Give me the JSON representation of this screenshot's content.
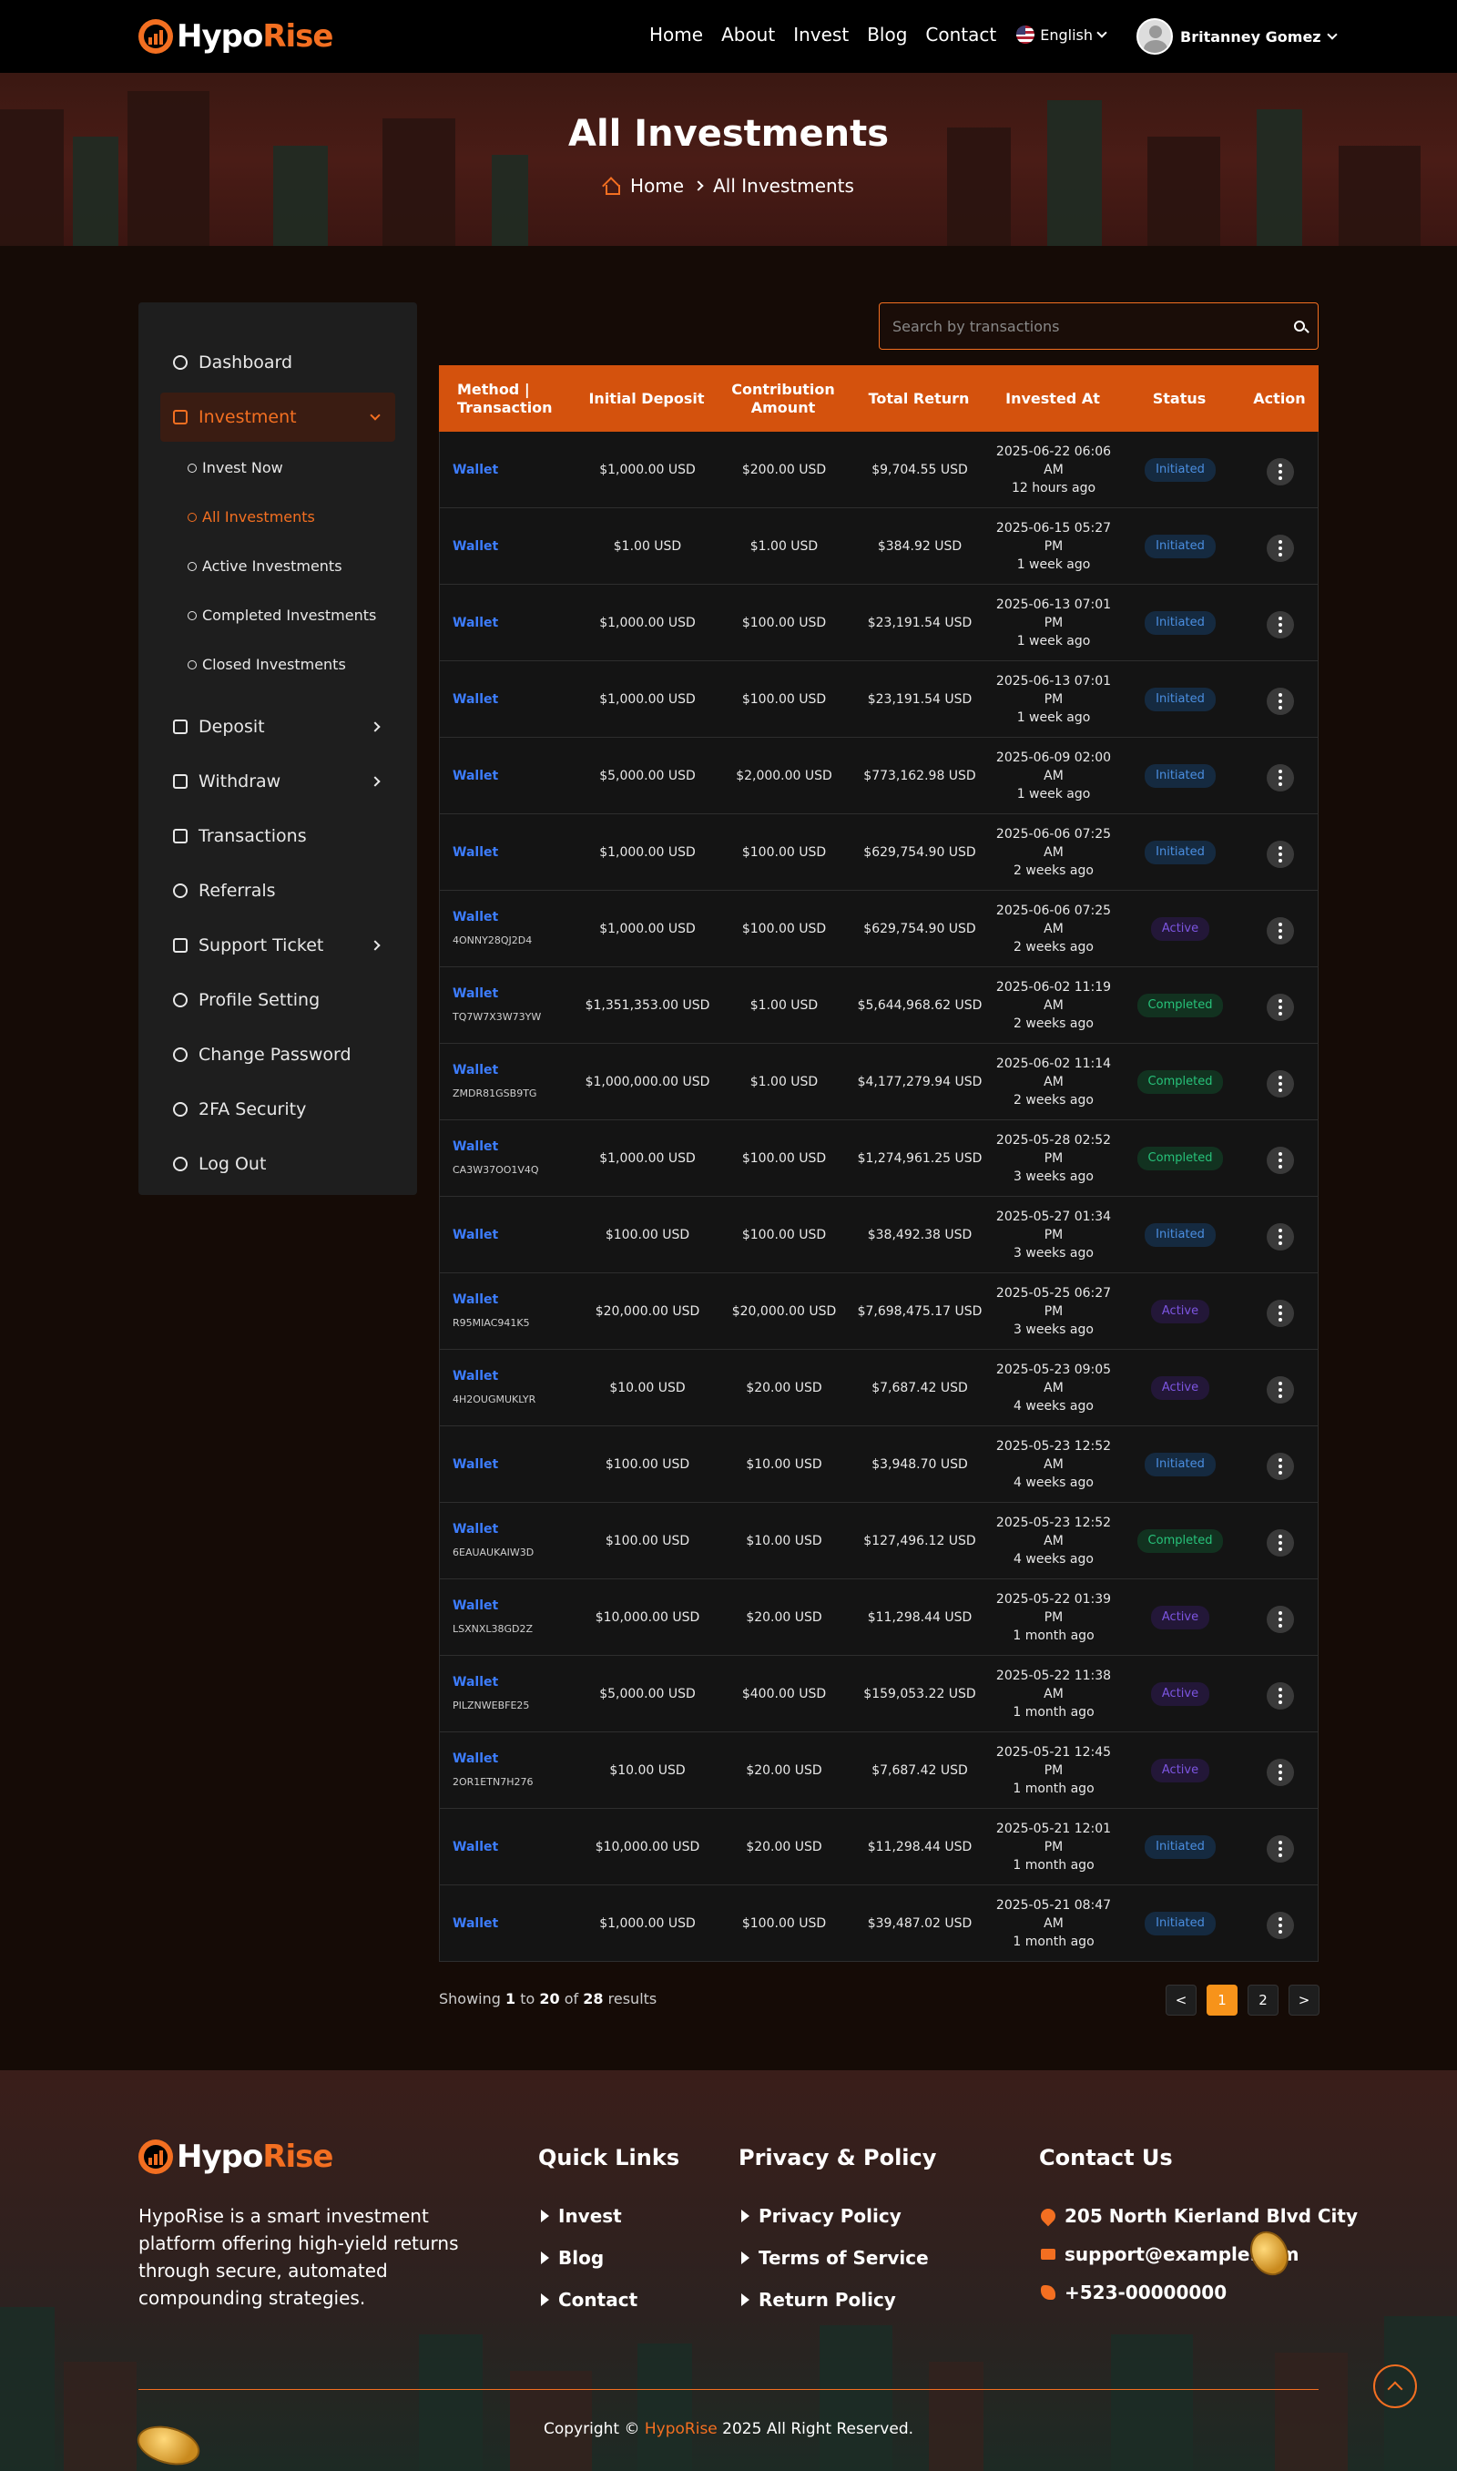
{
  "brand": {
    "name_white": "Hypo",
    "name_orange": "Rise"
  },
  "nav": {
    "items": [
      "Home",
      "About",
      "Invest",
      "Blog",
      "Contact"
    ],
    "language": "English"
  },
  "user": {
    "name": "Britanney Gomez"
  },
  "hero": {
    "title": "All Investments",
    "breadcrumb_home": "Home",
    "breadcrumb_current": "All Investments"
  },
  "sidebar": {
    "items": [
      {
        "label": "Dashboard",
        "icon": "gauge-icon"
      },
      {
        "label": "Investment",
        "icon": "chart-icon",
        "active": true
      },
      {
        "label": "Deposit",
        "icon": "wallet-icon"
      },
      {
        "label": "Withdraw",
        "icon": "withdraw-icon"
      },
      {
        "label": "Transactions",
        "icon": "swap-icon"
      },
      {
        "label": "Referrals",
        "icon": "handshake-icon"
      },
      {
        "label": "Support Ticket",
        "icon": "ticket-icon"
      },
      {
        "label": "Profile Setting",
        "icon": "user-icon"
      },
      {
        "label": "Change Password",
        "icon": "key-icon"
      },
      {
        "label": "2FA Security",
        "icon": "shield-user-icon"
      },
      {
        "label": "Log Out",
        "icon": "logout-icon"
      }
    ],
    "sub_items": [
      "Invest Now",
      "All Investments",
      "Active Investments",
      "Completed Investments",
      "Closed Investments"
    ]
  },
  "search": {
    "placeholder": "Search by transactions"
  },
  "table": {
    "headers": [
      "Method | Transaction",
      "Initial Deposit",
      "Contribution Amount",
      "Total Return",
      "Invested At",
      "Status",
      "Action"
    ],
    "rows": [
      {
        "method": "Wallet",
        "tx": "",
        "initial": "$1,000.00 USD",
        "contribution": "$200.00 USD",
        "total": "$9,704.55 USD",
        "date": "2025-06-22 06:06 AM",
        "ago": "12 hours ago",
        "status": "Initiated"
      },
      {
        "method": "Wallet",
        "tx": "",
        "initial": "$1.00 USD",
        "contribution": "$1.00 USD",
        "total": "$384.92 USD",
        "date": "2025-06-15 05:27 PM",
        "ago": "1 week ago",
        "status": "Initiated"
      },
      {
        "method": "Wallet",
        "tx": "",
        "initial": "$1,000.00 USD",
        "contribution": "$100.00 USD",
        "total": "$23,191.54 USD",
        "date": "2025-06-13 07:01 PM",
        "ago": "1 week ago",
        "status": "Initiated"
      },
      {
        "method": "Wallet",
        "tx": "",
        "initial": "$1,000.00 USD",
        "contribution": "$100.00 USD",
        "total": "$23,191.54 USD",
        "date": "2025-06-13 07:01 PM",
        "ago": "1 week ago",
        "status": "Initiated"
      },
      {
        "method": "Wallet",
        "tx": "",
        "initial": "$5,000.00 USD",
        "contribution": "$2,000.00 USD",
        "total": "$773,162.98 USD",
        "date": "2025-06-09 02:00 AM",
        "ago": "1 week ago",
        "status": "Initiated"
      },
      {
        "method": "Wallet",
        "tx": "",
        "initial": "$1,000.00 USD",
        "contribution": "$100.00 USD",
        "total": "$629,754.90 USD",
        "date": "2025-06-06 07:25 AM",
        "ago": "2 weeks ago",
        "status": "Initiated"
      },
      {
        "method": "Wallet",
        "tx": "4ONNY28QJ2D4",
        "initial": "$1,000.00 USD",
        "contribution": "$100.00 USD",
        "total": "$629,754.90 USD",
        "date": "2025-06-06 07:25 AM",
        "ago": "2 weeks ago",
        "status": "Active"
      },
      {
        "method": "Wallet",
        "tx": "TQ7W7X3W73YW",
        "initial": "$1,351,353.00 USD",
        "contribution": "$1.00 USD",
        "total": "$5,644,968.62 USD",
        "date": "2025-06-02 11:19 AM",
        "ago": "2 weeks ago",
        "status": "Completed"
      },
      {
        "method": "Wallet",
        "tx": "ZMDR81GSB9TG",
        "initial": "$1,000,000.00 USD",
        "contribution": "$1.00 USD",
        "total": "$4,177,279.94 USD",
        "date": "2025-06-02 11:14 AM",
        "ago": "2 weeks ago",
        "status": "Completed"
      },
      {
        "method": "Wallet",
        "tx": "CA3W37OO1V4Q",
        "initial": "$1,000.00 USD",
        "contribution": "$100.00 USD",
        "total": "$1,274,961.25 USD",
        "date": "2025-05-28 02:52 PM",
        "ago": "3 weeks ago",
        "status": "Completed"
      },
      {
        "method": "Wallet",
        "tx": "",
        "initial": "$100.00 USD",
        "contribution": "$100.00 USD",
        "total": "$38,492.38 USD",
        "date": "2025-05-27 01:34 PM",
        "ago": "3 weeks ago",
        "status": "Initiated"
      },
      {
        "method": "Wallet",
        "tx": "R95MIAC941K5",
        "initial": "$20,000.00 USD",
        "contribution": "$20,000.00 USD",
        "total": "$7,698,475.17 USD",
        "date": "2025-05-25 06:27 PM",
        "ago": "3 weeks ago",
        "status": "Active"
      },
      {
        "method": "Wallet",
        "tx": "4H2OUGMUKLYR",
        "initial": "$10.00 USD",
        "contribution": "$20.00 USD",
        "total": "$7,687.42 USD",
        "date": "2025-05-23 09:05 AM",
        "ago": "4 weeks ago",
        "status": "Active"
      },
      {
        "method": "Wallet",
        "tx": "",
        "initial": "$100.00 USD",
        "contribution": "$10.00 USD",
        "total": "$3,948.70 USD",
        "date": "2025-05-23 12:52 AM",
        "ago": "4 weeks ago",
        "status": "Initiated"
      },
      {
        "method": "Wallet",
        "tx": "6EAUAUKAIW3D",
        "initial": "$100.00 USD",
        "contribution": "$10.00 USD",
        "total": "$127,496.12 USD",
        "date": "2025-05-23 12:52 AM",
        "ago": "4 weeks ago",
        "status": "Completed"
      },
      {
        "method": "Wallet",
        "tx": "LSXNXL38GD2Z",
        "initial": "$10,000.00 USD",
        "contribution": "$20.00 USD",
        "total": "$11,298.44 USD",
        "date": "2025-05-22 01:39 PM",
        "ago": "1 month ago",
        "status": "Active"
      },
      {
        "method": "Wallet",
        "tx": "PILZNWEBFE25",
        "initial": "$5,000.00 USD",
        "contribution": "$400.00 USD",
        "total": "$159,053.22 USD",
        "date": "2025-05-22 11:38 AM",
        "ago": "1 month ago",
        "status": "Active"
      },
      {
        "method": "Wallet",
        "tx": "2OR1ETN7H276",
        "initial": "$10.00 USD",
        "contribution": "$20.00 USD",
        "total": "$7,687.42 USD",
        "date": "2025-05-21 12:45 PM",
        "ago": "1 month ago",
        "status": "Active"
      },
      {
        "method": "Wallet",
        "tx": "",
        "initial": "$10,000.00 USD",
        "contribution": "$20.00 USD",
        "total": "$11,298.44 USD",
        "date": "2025-05-21 12:01 PM",
        "ago": "1 month ago",
        "status": "Initiated"
      },
      {
        "method": "Wallet",
        "tx": "",
        "initial": "$1,000.00 USD",
        "contribution": "$100.00 USD",
        "total": "$39,487.02 USD",
        "date": "2025-05-21 08:47 AM",
        "ago": "1 month ago",
        "status": "Initiated"
      }
    ]
  },
  "pagination": {
    "showing_prefix": "Showing",
    "from": "1",
    "to_word": "to",
    "to": "20",
    "of_word": "of",
    "total": "28",
    "suffix": "results",
    "prev": "<",
    "pages": [
      "1",
      "2"
    ],
    "next": ">"
  },
  "footer": {
    "about": "HypoRise is a smart investment platform offering high-yield returns through secure, automated compounding strategies.",
    "quick_links_title": "Quick Links",
    "quick_links": [
      "Invest",
      "Blog",
      "Contact"
    ],
    "policy_title": "Privacy & Policy",
    "policy_links": [
      "Privacy Policy",
      "Terms of Service",
      "Return Policy"
    ],
    "contact_title": "Contact Us",
    "address": "205 North Kierland Blvd City",
    "email": "support@example.com",
    "phone": "+523-00000000",
    "copyright_pre": "Copyright ©",
    "copyright_brand": "HypoRise",
    "copyright_post": "2025 All Right Reserved."
  },
  "colors": {
    "accent": "#f36f21",
    "header_bg": "#000000",
    "table_head": "#d4520d",
    "link_blue": "#3d7dff"
  }
}
